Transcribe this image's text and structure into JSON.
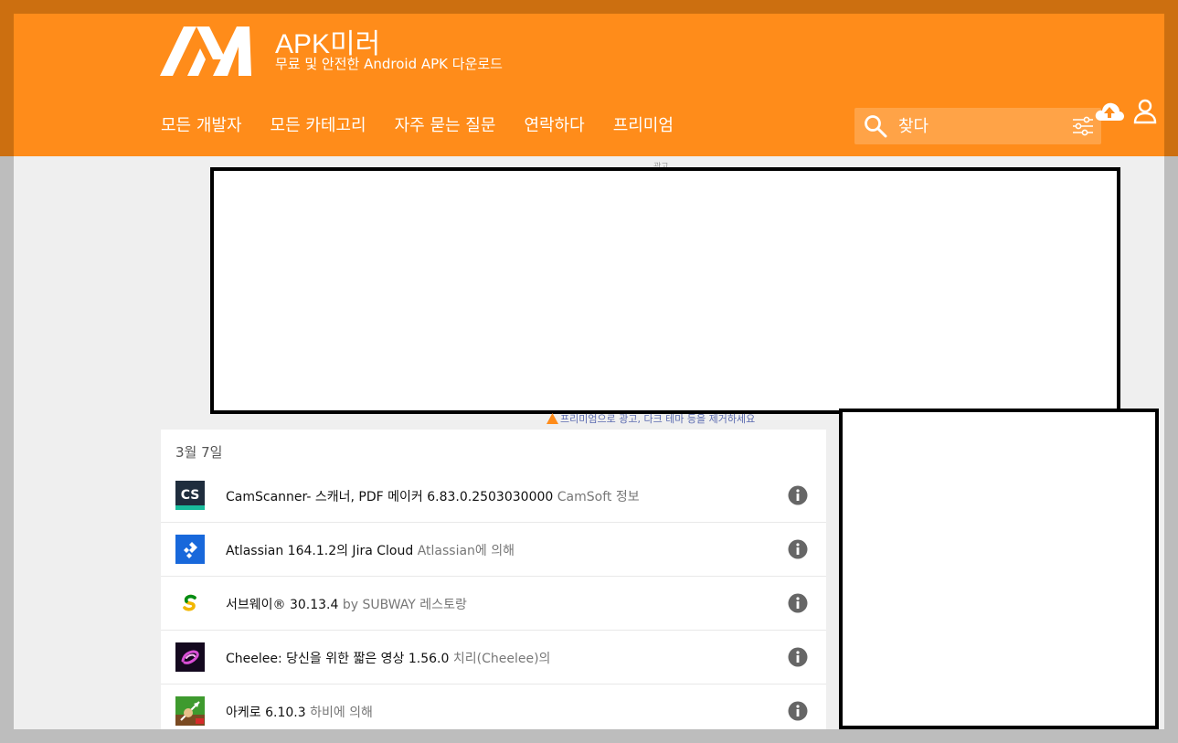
{
  "site": {
    "title": "APK미러",
    "subtitle": "무료 및 안전한 Android APK 다운로드"
  },
  "nav": [
    {
      "label": "모든 개발자"
    },
    {
      "label": "모든 카테고리"
    },
    {
      "label": "자주 묻는 질문"
    },
    {
      "label": "연락하다"
    },
    {
      "label": "프리미엄"
    }
  ],
  "search": {
    "placeholder": "찾다"
  },
  "ad": {
    "label": "광고",
    "premium_note": "프리미엄으로 광고, 다크 테마 등을 제거하세요"
  },
  "list": {
    "date": "3월 7일",
    "items": [
      {
        "name": "CamScanner- 스캐너, PDF 메이커 6.83.0.2503030000",
        "dev": "CamSoft 정보",
        "icon": "camscanner-icon"
      },
      {
        "name": "Atlassian 164.1.2의 Jira Cloud",
        "dev": "Atlassian에 의해",
        "icon": "jira-icon"
      },
      {
        "name": "서브웨이® 30.13.4",
        "dev": "by SUBWAY 레스토랑",
        "icon": "subway-icon"
      },
      {
        "name": "Cheelee: 당신을 위한 짧은 영상 1.56.0",
        "dev": "치리(Cheelee)의",
        "icon": "cheelee-icon"
      },
      {
        "name": "아케로 6.10.3",
        "dev": "하비에 의해",
        "icon": "archero-icon"
      }
    ]
  },
  "colors": {
    "brand": "#ff8c1a",
    "frame": "#cc6f10",
    "background": "#efefef"
  }
}
